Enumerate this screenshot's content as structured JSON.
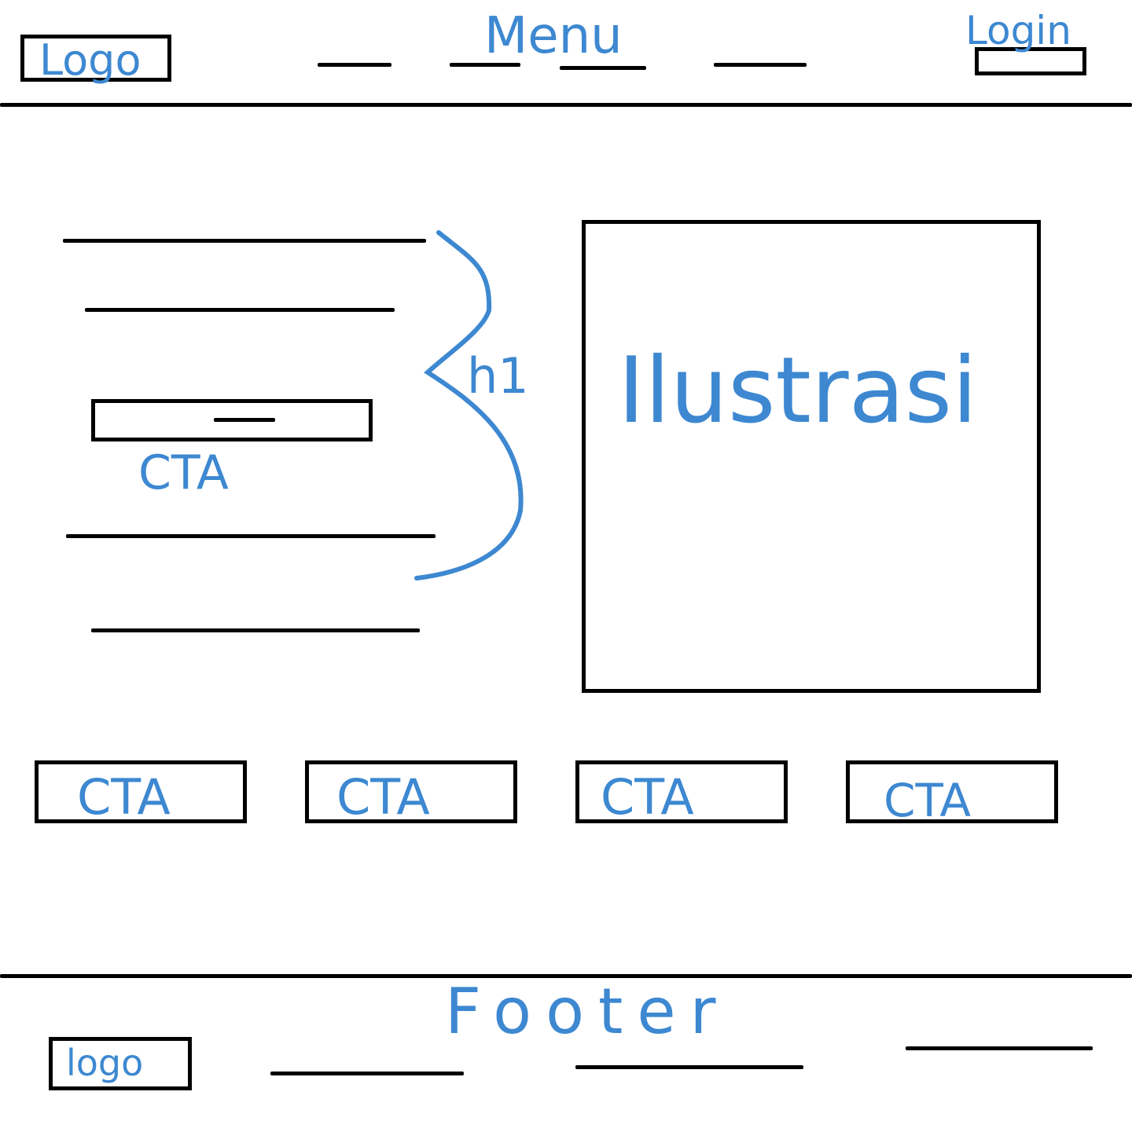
{
  "header": {
    "logo_label": "Logo",
    "menu_label": "Menu",
    "login_label": "Login"
  },
  "hero": {
    "heading_annotation": "h1",
    "cta_label": "CTA",
    "illustration_label": "Ilustrasi"
  },
  "cta_row": [
    {
      "label": "CTA"
    },
    {
      "label": "CTA"
    },
    {
      "label": "CTA"
    },
    {
      "label": "CTA"
    }
  ],
  "footer": {
    "title": "Footer",
    "logo_label": "logo"
  },
  "colors": {
    "ink": "#000000",
    "annotation": "#3d88d1"
  }
}
